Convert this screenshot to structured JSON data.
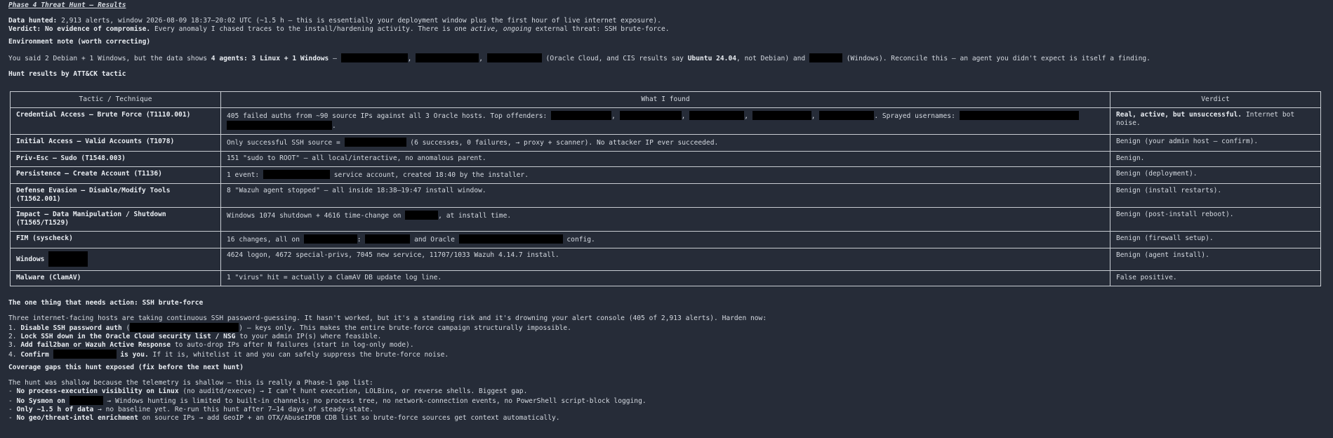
{
  "title": "Phase 4 Threat Hunt — Results",
  "summary": {
    "data_label": "Data hunted:",
    "data_text": " 2,913 alerts, window 2026-08-09 18:37–20:02 UTC (~1.5 h — this is essentially your deployment window plus the first hour of live internet exposure).",
    "verdict_label": "Verdict: No evidence of compromise.",
    "verdict_text_a": " Every anomaly I chased traces to the install/hardening activity. There is one ",
    "verdict_em": "active, ongoing",
    "verdict_text_b": " external threat: SSH brute-force."
  },
  "env": {
    "heading": "Environment note (worth correcting)",
    "t1": "You said 2 Debian + 1 Windows, but the data shows ",
    "b1": "4 agents: 3 Linux + 1 Windows",
    "t2": " — ",
    "sep": ", ",
    "t3": " (Oracle Cloud, and CIS results say ",
    "b2": "Ubuntu 24.04",
    "t4": ", not Debian) and ",
    "t5": " (Windows). Reconcile this — an agent you didn't expect is itself a finding."
  },
  "hunt": {
    "heading": "Hunt results by ATT&CK tactic",
    "columns": [
      "Tactic / Technique",
      "What I found",
      "Verdict"
    ],
    "rows": [
      {
        "tactic": "Credential Access — Brute Force (T1110.001)",
        "verdict_b": "Real, active, but unsuccessful.",
        "verdict": " Internet bot noise."
      },
      {
        "tactic": "Initial Access — Valid Accounts (T1078)",
        "verdict_b": "",
        "verdict": "Benign (your admin host — confirm)."
      },
      {
        "tactic": "Priv-Esc — Sudo (T1548.003)",
        "found": "151 \"sudo to ROOT\" — all local/interactive, no anomalous parent.",
        "verdict_b": "",
        "verdict": "Benign."
      },
      {
        "tactic": "Persistence — Create Account (T1136)",
        "verdict_b": "",
        "verdict": "Benign (deployment)."
      },
      {
        "tactic": "Defense Evasion — Disable/Modify Tools (T1562.001)",
        "found": "8 \"Wazuh agent stopped\" — all inside 18:38–19:47 install window.",
        "verdict_b": "",
        "verdict": "Benign (install restarts)."
      },
      {
        "tactic": "Impact — Data Manipulation / Shutdown (T1565/T1529)",
        "verdict_b": "",
        "verdict": "Benign (post-install reboot)."
      },
      {
        "tactic": "FIM (syscheck)",
        "verdict_b": "",
        "verdict": "Benign (firewall setup)."
      },
      {
        "tactic": "Windows",
        "found": "4624 logon, 4672 special-privs, 7045 new service, 11707/1033 Wazuh 4.14.7 install.",
        "verdict_b": "",
        "verdict": "Benign (agent install)."
      },
      {
        "tactic": "Malware (ClamAV)",
        "found": "1 \"virus\" hit = actually a ClamAV DB update log line.",
        "verdict_b": "",
        "verdict": "False positive."
      }
    ],
    "r1_a": "405 failed auths from ~90 source IPs against all 3 Oracle hosts. Top offenders: ",
    "r1_b": ". Sprayed usernames: ",
    "r1_c": ".",
    "r2_a": "Only successful SSH source = ",
    "r2_b": " (6 successes, 0 failures, → proxy + scanner). No attacker IP ever succeeded.",
    "r4_a": "1 event: ",
    "r4_b": " service account, created 18:40 by the installer.",
    "r6_a": "Windows 1074 shutdown + 4616 time-change on ",
    "r6_b": ", at install time.",
    "r7_a": "16 changes, all on ",
    "r7_b": ": ",
    "r7_c": " and Oracle ",
    "r7_d": " config."
  },
  "action": {
    "heading": "The one thing that needs action: SSH brute-force",
    "intro": "Three internet-facing hosts are taking continuous SSH password-guessing. It hasn't worked, but it's a standing risk and it's drowning your alert console (405 of 2,913 alerts). Harden now:",
    "i1_n": "1. ",
    "i1_b": "Disable SSH password auth",
    "i1_a": " (",
    "i1_c": ") — keys only. This makes the entire brute-force campaign structurally impossible.",
    "i2_n": "2. ",
    "i2_b": "Lock SSH down in the Oracle Cloud security list / NSG",
    "i2_c": " to your admin IP(s) where feasible.",
    "i3_n": "3. ",
    "i3_b": "Add fail2ban or Wazuh Active Response",
    "i3_c": " to auto-drop IPs after N failures (start in log-only mode).",
    "i4_n": "4. ",
    "i4_b1": "Confirm ",
    "i4_b2": " is you.",
    "i4_c": " If it is, whitelist it and you can safely suppress the brute-force noise."
  },
  "gaps": {
    "heading": "Coverage gaps this hunt exposed (fix before the next hunt)",
    "intro": "The hunt was shallow because the telemetry is shallow — this is really a Phase-1 gap list:",
    "g1_d": "- ",
    "g1_b": "No process-execution visibility on Linux",
    "g1_c": " (no auditd/execve) → I can't hunt execution, LOLBins, or reverse shells. Biggest gap.",
    "g2_d": "- ",
    "g2_b": "No Sysmon on ",
    "g2_c": " → Windows hunting is limited to built-in channels; no process tree, no network-connection events, no PowerShell script-block logging.",
    "g3_d": "- ",
    "g3_b": "Only ~1.5 h of data",
    "g3_c": " → no baseline yet. Re-run this hunt after 7–14 days of steady-state.",
    "g4_d": "- ",
    "g4_b": "No geo/threat-intel enrichment",
    "g4_c": " on source IPs → add GeoIP + an OTX/AbuseIPDB CDB list so brute-force sources get context automatically."
  }
}
